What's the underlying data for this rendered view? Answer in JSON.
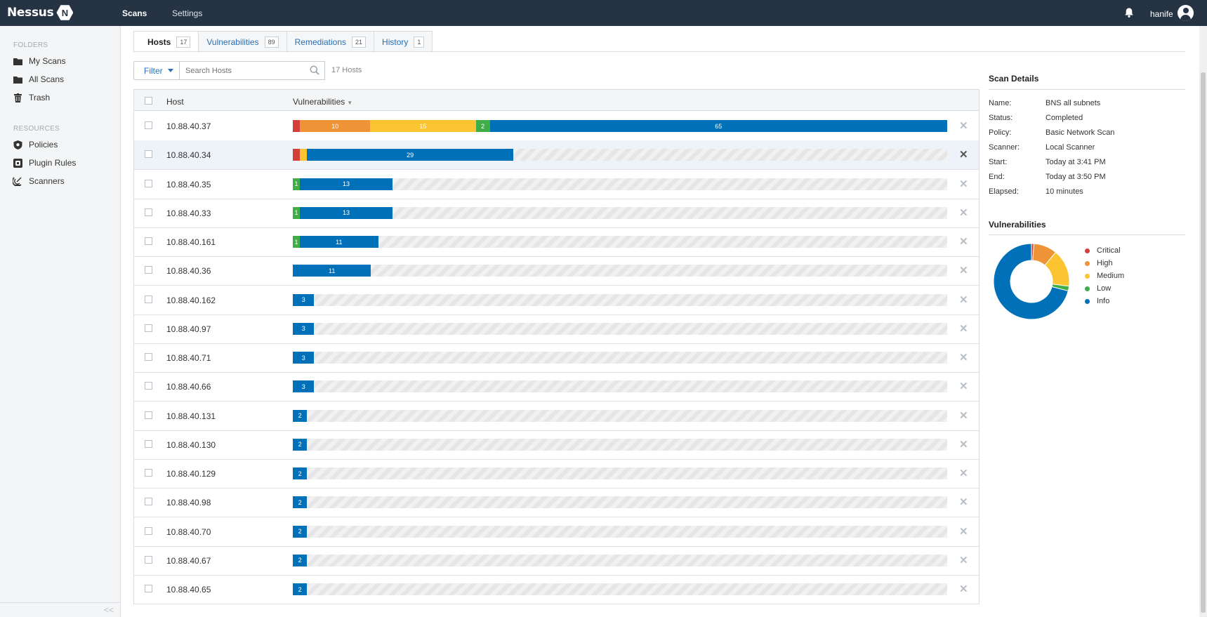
{
  "app": {
    "logo_text": "Nessus",
    "logo_mark": "N",
    "nav": [
      {
        "label": "Scans"
      },
      {
        "label": "Settings"
      }
    ],
    "user": "hanife"
  },
  "sidebar": {
    "folders_heading": "FOLDERS",
    "folders": [
      {
        "label": "My Scans",
        "icon": "folder-icon"
      },
      {
        "label": "All Scans",
        "icon": "folder-icon"
      },
      {
        "label": "Trash",
        "icon": "trash-icon"
      }
    ],
    "resources_heading": "RESOURCES",
    "resources": [
      {
        "label": "Policies",
        "icon": "shield-icon"
      },
      {
        "label": "Plugin Rules",
        "icon": "plugin-icon"
      },
      {
        "label": "Scanners",
        "icon": "radar-icon"
      }
    ],
    "collapse": "<<"
  },
  "tabs": [
    {
      "label": "Hosts",
      "count": "17",
      "active": true
    },
    {
      "label": "Vulnerabilities",
      "count": "89"
    },
    {
      "label": "Remediations",
      "count": "21"
    },
    {
      "label": "History",
      "count": "1"
    }
  ],
  "toolbar": {
    "filter_label": "Filter",
    "search_placeholder": "Search Hosts",
    "host_count": "17 Hosts"
  },
  "table": {
    "col_host": "Host",
    "col_vulns": "Vulnerabilities",
    "sort_indicator": "▼",
    "max_total": 92,
    "rows": [
      {
        "host": "10.88.40.37",
        "segments": [
          {
            "sev": "critical",
            "v": 1,
            "label": ""
          },
          {
            "sev": "high",
            "v": 10,
            "label": "10"
          },
          {
            "sev": "medium",
            "v": 15,
            "label": "15"
          },
          {
            "sev": "low",
            "v": 2,
            "label": "2"
          },
          {
            "sev": "info",
            "v": 65,
            "label": "65"
          }
        ]
      },
      {
        "host": "10.88.40.34",
        "highlight": true,
        "segments": [
          {
            "sev": "critical",
            "v": 1,
            "label": ""
          },
          {
            "sev": "medium",
            "v": 1,
            "label": ""
          },
          {
            "sev": "info",
            "v": 29,
            "label": "29"
          }
        ]
      },
      {
        "host": "10.88.40.35",
        "segments": [
          {
            "sev": "low",
            "v": 1,
            "label": "1"
          },
          {
            "sev": "info",
            "v": 13,
            "label": "13"
          }
        ]
      },
      {
        "host": "10.88.40.33",
        "segments": [
          {
            "sev": "low",
            "v": 1,
            "label": "1"
          },
          {
            "sev": "info",
            "v": 13,
            "label": "13"
          }
        ]
      },
      {
        "host": "10.88.40.161",
        "segments": [
          {
            "sev": "low",
            "v": 1,
            "label": "1"
          },
          {
            "sev": "info",
            "v": 11,
            "label": "11"
          }
        ]
      },
      {
        "host": "10.88.40.36",
        "segments": [
          {
            "sev": "info",
            "v": 11,
            "label": "11"
          }
        ]
      },
      {
        "host": "10.88.40.162",
        "segments": [
          {
            "sev": "info",
            "v": 3,
            "label": "3"
          }
        ]
      },
      {
        "host": "10.88.40.97",
        "segments": [
          {
            "sev": "info",
            "v": 3,
            "label": "3"
          }
        ]
      },
      {
        "host": "10.88.40.71",
        "segments": [
          {
            "sev": "info",
            "v": 3,
            "label": "3"
          }
        ]
      },
      {
        "host": "10.88.40.66",
        "segments": [
          {
            "sev": "info",
            "v": 3,
            "label": "3"
          }
        ]
      },
      {
        "host": "10.88.40.131",
        "segments": [
          {
            "sev": "info",
            "v": 2,
            "label": "2"
          }
        ]
      },
      {
        "host": "10.88.40.130",
        "segments": [
          {
            "sev": "info",
            "v": 2,
            "label": "2"
          }
        ]
      },
      {
        "host": "10.88.40.129",
        "segments": [
          {
            "sev": "info",
            "v": 2,
            "label": "2"
          }
        ]
      },
      {
        "host": "10.88.40.98",
        "segments": [
          {
            "sev": "info",
            "v": 2,
            "label": "2"
          }
        ]
      },
      {
        "host": "10.88.40.70",
        "segments": [
          {
            "sev": "info",
            "v": 2,
            "label": "2"
          }
        ]
      },
      {
        "host": "10.88.40.67",
        "segments": [
          {
            "sev": "info",
            "v": 2,
            "label": "2"
          }
        ]
      },
      {
        "host": "10.88.40.65",
        "segments": [
          {
            "sev": "info",
            "v": 2,
            "label": "2"
          }
        ]
      }
    ]
  },
  "scan_details": {
    "title": "Scan Details",
    "items": [
      {
        "k": "Name:",
        "v": "BNS all subnets"
      },
      {
        "k": "Status:",
        "v": "Completed"
      },
      {
        "k": "Policy:",
        "v": "Basic Network Scan"
      },
      {
        "k": "Scanner:",
        "v": "Local Scanner"
      },
      {
        "k": "Start:",
        "v": "Today at 3:41 PM"
      },
      {
        "k": "End:",
        "v": "Today at 3:50 PM"
      },
      {
        "k": "Elapsed:",
        "v": "10 minutes"
      }
    ]
  },
  "severity_colors": {
    "critical": "#d43f3a",
    "high": "#ee9336",
    "medium": "#fdc431",
    "low": "#3fae49",
    "info": "#0071b9"
  },
  "vuln_chart": {
    "title": "Vulnerabilities",
    "legend": [
      {
        "label": "Critical",
        "sev": "critical",
        "value": 1
      },
      {
        "label": "High",
        "sev": "high",
        "value": 10
      },
      {
        "label": "Medium",
        "sev": "medium",
        "value": 16
      },
      {
        "label": "Low",
        "sev": "low",
        "value": 2
      },
      {
        "label": "Info",
        "sev": "info",
        "value": 71
      }
    ]
  }
}
